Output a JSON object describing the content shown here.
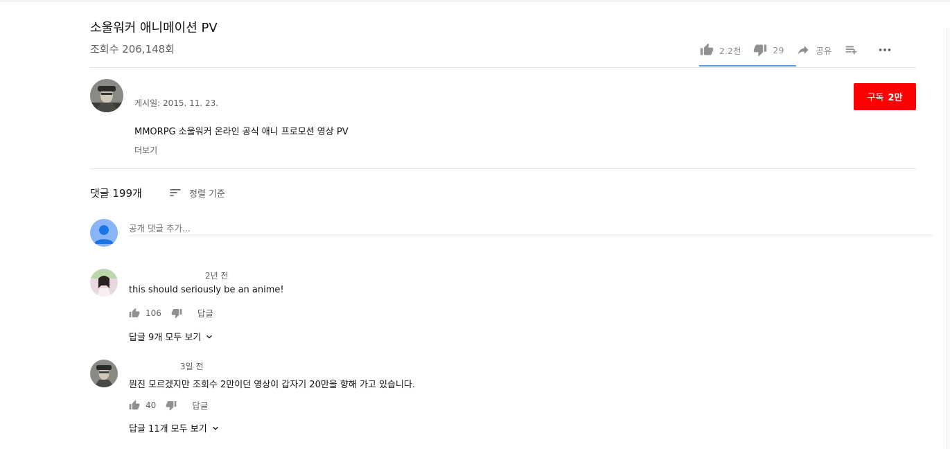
{
  "video": {
    "title": "소울워커 애니메이션 PV",
    "views": "조회수 206,148회",
    "likes": "2.2천",
    "dislikes": "29",
    "share_label": "공유"
  },
  "channel": {
    "published": "게시일: 2015. 11. 23.",
    "subscribe_label": "구독",
    "subscriber_count": "2만",
    "description": "MMORPG 소울워커 온라인 공식 애니 프로모션 영상 PV",
    "more_label": "더보기"
  },
  "comments_header": {
    "count_label": "댓글 199개",
    "sort_label": "정렬 기준",
    "add_placeholder": "공개 댓글 추가..."
  },
  "comments": [
    {
      "time": "2년 전",
      "text": "this should seriously be an anime!",
      "likes": "106",
      "reply_label": "답글",
      "view_replies": "답글 9개 모두 보기"
    },
    {
      "time": "3일 전",
      "text": "뭔진 모르겠지만 조회수 2만이던 영상이 갑자기 20만을 향해 가고 있습니다.",
      "likes": "40",
      "reply_label": "답글",
      "view_replies": "답글 11개 모두 보기"
    }
  ],
  "colors": {
    "subscribe": "#ff0000",
    "like_bar": "#3ea6ff",
    "user_avatar": "#8ab4f8"
  }
}
